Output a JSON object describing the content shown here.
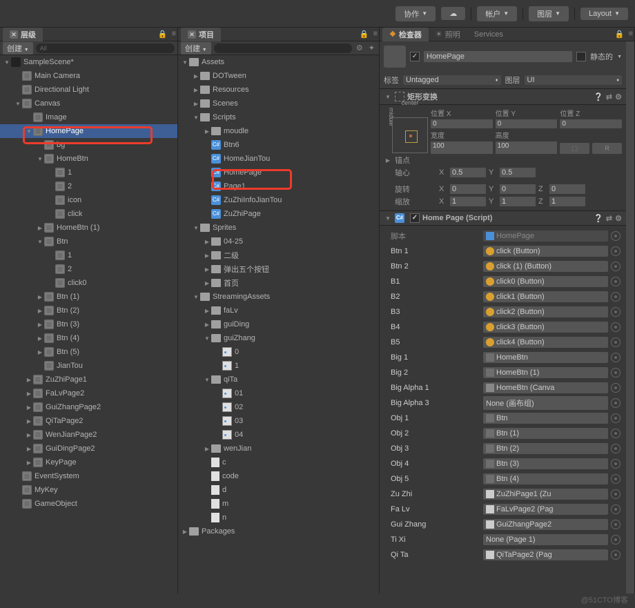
{
  "topbar": {
    "collab": "协作",
    "account": "帐户",
    "layers": "图层",
    "layout": "Layout"
  },
  "panels": {
    "hierarchy_tab": "层级",
    "project_tab": "项目",
    "inspector_tab": "检查器",
    "lighting_tab": "照明",
    "services_tab": "Services",
    "create": "创建",
    "search_ph": "All"
  },
  "hierarchy": [
    {
      "d": 0,
      "f": "open",
      "i": "unity",
      "t": "SampleScene*"
    },
    {
      "d": 1,
      "f": "none",
      "i": "cube",
      "t": "Main Camera"
    },
    {
      "d": 1,
      "f": "none",
      "i": "cube",
      "t": "Directional Light"
    },
    {
      "d": 1,
      "f": "open",
      "i": "cube",
      "t": "Canvas"
    },
    {
      "d": 2,
      "f": "none",
      "i": "cube",
      "t": "Image"
    },
    {
      "d": 2,
      "f": "open",
      "i": "cube",
      "t": "HomePage",
      "sel": true
    },
    {
      "d": 3,
      "f": "none",
      "i": "cube",
      "t": "bg"
    },
    {
      "d": 3,
      "f": "open",
      "i": "cube",
      "t": "HomeBtn"
    },
    {
      "d": 4,
      "f": "none",
      "i": "cube",
      "t": "1"
    },
    {
      "d": 4,
      "f": "none",
      "i": "cube",
      "t": "2"
    },
    {
      "d": 4,
      "f": "none",
      "i": "cube",
      "t": "icon"
    },
    {
      "d": 4,
      "f": "none",
      "i": "cube",
      "t": "click"
    },
    {
      "d": 3,
      "f": "closed",
      "i": "cube",
      "t": "HomeBtn (1)"
    },
    {
      "d": 3,
      "f": "open",
      "i": "cube",
      "t": "Btn"
    },
    {
      "d": 4,
      "f": "none",
      "i": "cube",
      "t": "1"
    },
    {
      "d": 4,
      "f": "none",
      "i": "cube",
      "t": "2"
    },
    {
      "d": 4,
      "f": "none",
      "i": "cube",
      "t": "click0"
    },
    {
      "d": 3,
      "f": "closed",
      "i": "cube",
      "t": "Btn (1)"
    },
    {
      "d": 3,
      "f": "closed",
      "i": "cube",
      "t": "Btn (2)"
    },
    {
      "d": 3,
      "f": "closed",
      "i": "cube",
      "t": "Btn (3)"
    },
    {
      "d": 3,
      "f": "closed",
      "i": "cube",
      "t": "Btn (4)"
    },
    {
      "d": 3,
      "f": "closed",
      "i": "cube",
      "t": "Btn (5)"
    },
    {
      "d": 3,
      "f": "none",
      "i": "cube",
      "t": "JianTou"
    },
    {
      "d": 2,
      "f": "closed",
      "i": "cube",
      "t": "ZuZhiPage1"
    },
    {
      "d": 2,
      "f": "closed",
      "i": "cube",
      "t": "FaLvPage2"
    },
    {
      "d": 2,
      "f": "closed",
      "i": "cube",
      "t": "GuiZhangPage2"
    },
    {
      "d": 2,
      "f": "closed",
      "i": "cube",
      "t": "QiTaPage2"
    },
    {
      "d": 2,
      "f": "closed",
      "i": "cube",
      "t": "WenJianPage2"
    },
    {
      "d": 2,
      "f": "closed",
      "i": "cube",
      "t": "GuiDingPage2"
    },
    {
      "d": 2,
      "f": "closed",
      "i": "cube",
      "t": "KeyPage"
    },
    {
      "d": 1,
      "f": "none",
      "i": "cube",
      "t": "EventSystem"
    },
    {
      "d": 1,
      "f": "none",
      "i": "cube",
      "t": "MyKey"
    },
    {
      "d": 1,
      "f": "none",
      "i": "cube",
      "t": "GameObject"
    }
  ],
  "project": [
    {
      "d": 0,
      "f": "open",
      "i": "folder",
      "t": "Assets"
    },
    {
      "d": 1,
      "f": "closed",
      "i": "folder",
      "t": "DOTween"
    },
    {
      "d": 1,
      "f": "closed",
      "i": "folder",
      "t": "Resources"
    },
    {
      "d": 1,
      "f": "closed",
      "i": "folder",
      "t": "Scenes"
    },
    {
      "d": 1,
      "f": "open",
      "i": "folder",
      "t": "Scripts"
    },
    {
      "d": 2,
      "f": "closed",
      "i": "folder",
      "t": "moudle"
    },
    {
      "d": 2,
      "f": "none",
      "i": "cs",
      "t": "Btn6"
    },
    {
      "d": 2,
      "f": "none",
      "i": "cs",
      "t": "HomeJianTou"
    },
    {
      "d": 2,
      "f": "none",
      "i": "cs",
      "t": "HomePage",
      "mark": true
    },
    {
      "d": 2,
      "f": "none",
      "i": "cs",
      "t": "Page1"
    },
    {
      "d": 2,
      "f": "none",
      "i": "cs",
      "t": "ZuZhiInfoJianTou"
    },
    {
      "d": 2,
      "f": "none",
      "i": "cs",
      "t": "ZuZhiPage"
    },
    {
      "d": 1,
      "f": "open",
      "i": "folder",
      "t": "Sprites"
    },
    {
      "d": 2,
      "f": "closed",
      "i": "folder",
      "t": "04-25"
    },
    {
      "d": 2,
      "f": "closed",
      "i": "folder",
      "t": "二级"
    },
    {
      "d": 2,
      "f": "closed",
      "i": "folder",
      "t": "弹出五个按钮"
    },
    {
      "d": 2,
      "f": "closed",
      "i": "folder",
      "t": "首页"
    },
    {
      "d": 1,
      "f": "open",
      "i": "folder",
      "t": "StreamingAssets"
    },
    {
      "d": 2,
      "f": "closed",
      "i": "folder",
      "t": "faLv"
    },
    {
      "d": 2,
      "f": "closed",
      "i": "folder",
      "t": "guiDing"
    },
    {
      "d": 2,
      "f": "open",
      "i": "folder",
      "t": "guiZhang"
    },
    {
      "d": 3,
      "f": "none",
      "i": "img",
      "t": "0"
    },
    {
      "d": 3,
      "f": "none",
      "i": "img",
      "t": "1"
    },
    {
      "d": 2,
      "f": "open",
      "i": "folder",
      "t": "qiTa"
    },
    {
      "d": 3,
      "f": "none",
      "i": "img",
      "t": "01"
    },
    {
      "d": 3,
      "f": "none",
      "i": "img",
      "t": "02"
    },
    {
      "d": 3,
      "f": "none",
      "i": "img",
      "t": "03"
    },
    {
      "d": 3,
      "f": "none",
      "i": "img",
      "t": "04"
    },
    {
      "d": 2,
      "f": "closed",
      "i": "folder",
      "t": "wenJian"
    },
    {
      "d": 2,
      "f": "none",
      "i": "txt",
      "t": "c"
    },
    {
      "d": 2,
      "f": "none",
      "i": "txt",
      "t": "code"
    },
    {
      "d": 2,
      "f": "none",
      "i": "txt",
      "t": "d"
    },
    {
      "d": 2,
      "f": "none",
      "i": "txt",
      "t": "m"
    },
    {
      "d": 2,
      "f": "none",
      "i": "txt",
      "t": "n"
    },
    {
      "d": 0,
      "f": "closed",
      "i": "folder",
      "t": "Packages"
    }
  ],
  "inspector": {
    "name": "HomePage",
    "static": "静态的",
    "tag_lbl": "标签",
    "tag_val": "Untagged",
    "layer_lbl": "图层",
    "layer_val": "UI",
    "rect_title": "矩形变换",
    "anchor_c": "center",
    "anchor_m": "middle",
    "posx": "位置 X",
    "posy": "位置 Y",
    "posz": "位置 Z",
    "posxv": "0",
    "posyv": "0",
    "poszv": "0",
    "width": "宽度",
    "height": "高度",
    "widthv": "100",
    "heightv": "100",
    "anchors": "锚点",
    "pivot": "轴心",
    "pivotx": "0.5",
    "pivoty": "0.5",
    "rot": "旋转",
    "rotx": "0",
    "roty": "0",
    "rotz": "0",
    "scale": "缩放",
    "sx": "1",
    "sy": "1",
    "sz": "1",
    "script_title": "Home Page (Script)",
    "script_lbl": "脚本",
    "script_val": "HomePage",
    "props": [
      {
        "l": "Btn 1",
        "v": "click (Button)",
        "i": "btn"
      },
      {
        "l": "Btn 2",
        "v": "click (1) (Button)",
        "i": "btn"
      },
      {
        "l": "B1",
        "v": "click0 (Button)",
        "i": "btn"
      },
      {
        "l": "B2",
        "v": "click1 (Button)",
        "i": "btn"
      },
      {
        "l": "B3",
        "v": "click2 (Button)",
        "i": "btn"
      },
      {
        "l": "B4",
        "v": "click3 (Button)",
        "i": "btn"
      },
      {
        "l": "B5",
        "v": "click4 (Button)",
        "i": "btn"
      },
      {
        "l": "Big 1",
        "v": "HomeBtn",
        "i": "go"
      },
      {
        "l": "Big 2",
        "v": "HomeBtn (1)",
        "i": "go"
      },
      {
        "l": "Big Alpha 1",
        "v": "HomeBtn (Canva",
        "i": "grid"
      },
      {
        "l": "Big Alpha 3",
        "v": "None (画布组)",
        "i": ""
      },
      {
        "l": "Obj 1",
        "v": "Btn",
        "i": "go"
      },
      {
        "l": "Obj 2",
        "v": "Btn (1)",
        "i": "go"
      },
      {
        "l": "Obj 3",
        "v": "Btn (2)",
        "i": "go"
      },
      {
        "l": "Obj 4",
        "v": "Btn (3)",
        "i": "go"
      },
      {
        "l": "Obj 5",
        "v": "Btn (4)",
        "i": "go"
      },
      {
        "l": "Zu Zhi",
        "v": "ZuZhiPage1 (Zu",
        "i": "pg"
      },
      {
        "l": "Fa Lv",
        "v": "FaLvPage2 (Pag",
        "i": "pg"
      },
      {
        "l": "Gui Zhang",
        "v": "GuiZhangPage2",
        "i": "pg"
      },
      {
        "l": "Ti Xi",
        "v": "None (Page 1)",
        "i": ""
      },
      {
        "l": "Qi Ta",
        "v": "QiTaPage2 (Pag",
        "i": "pg"
      }
    ]
  },
  "watermark": "@51CTO博客"
}
